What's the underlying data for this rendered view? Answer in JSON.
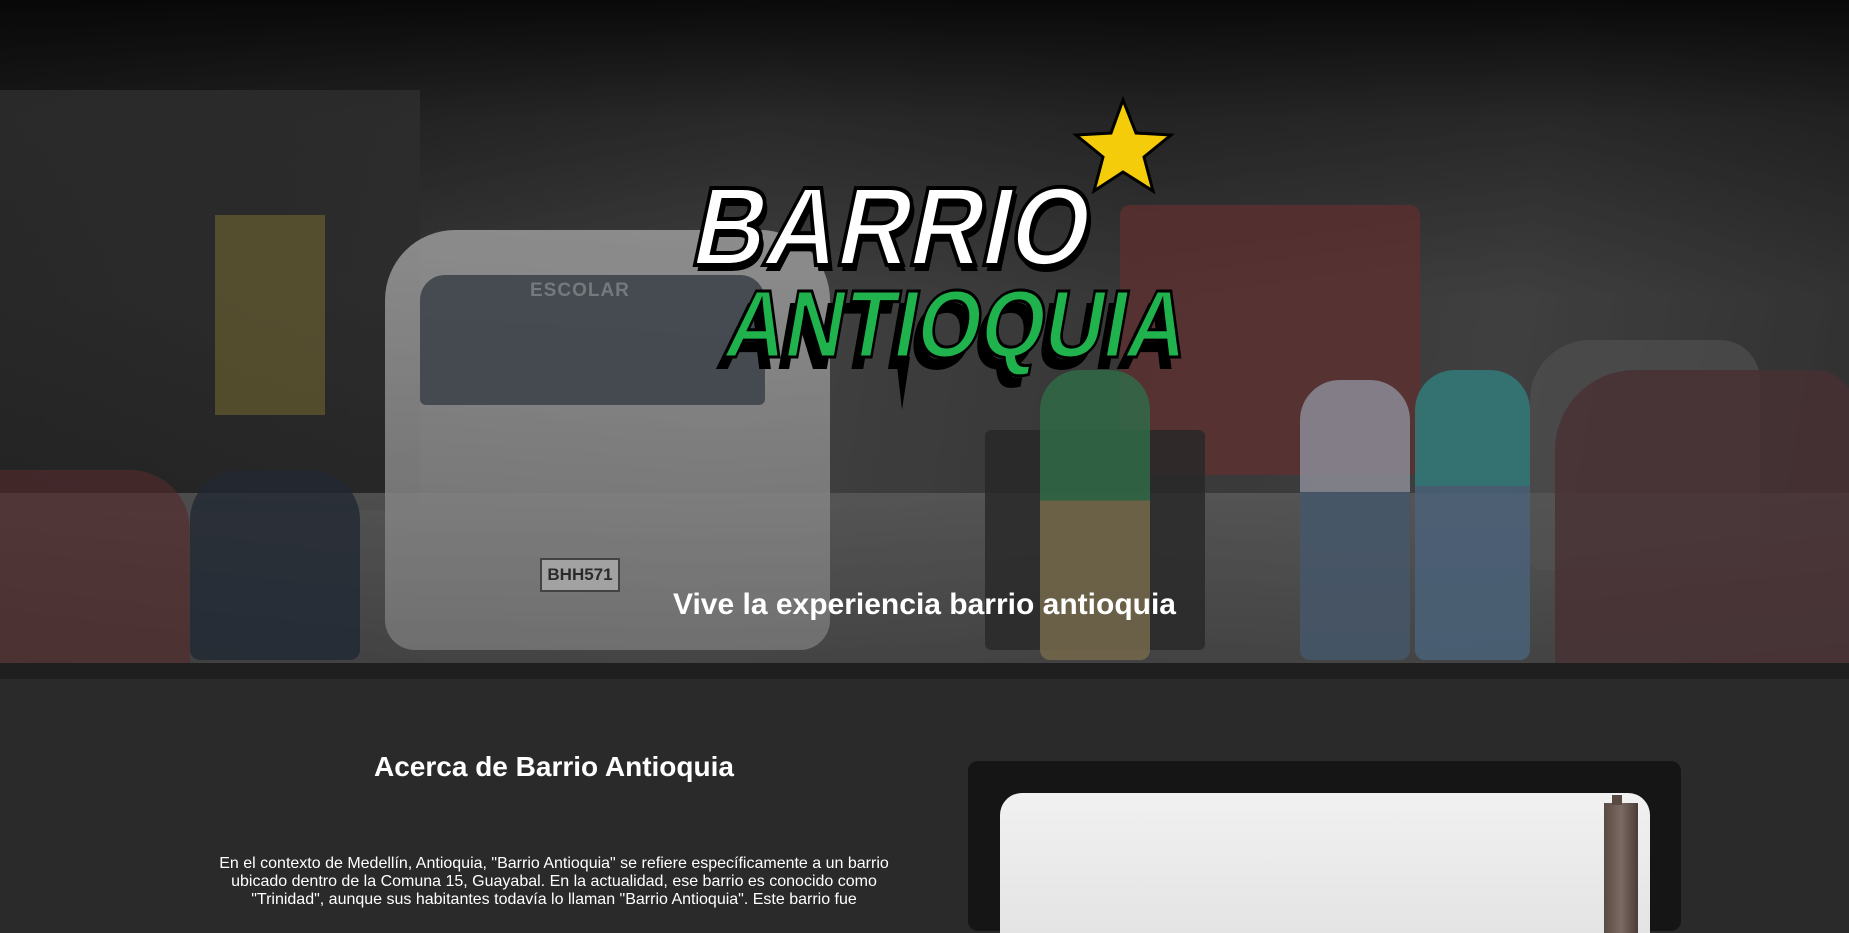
{
  "hero": {
    "logo": {
      "line1": "BARRIO",
      "line2": "ANTIOQUIA",
      "colors": {
        "line1_fill": "#ffffff",
        "line2_fill": "#1fb24d",
        "star": "#f5cc0a",
        "outline": "#000000"
      },
      "icon": "star-icon"
    },
    "background_scene": {
      "van_label": "ESCOLAR",
      "van_plate": "BHH571"
    },
    "tagline": "Vive la experiencia barrio antioquia"
  },
  "about": {
    "title": "Acerca de Barrio Antioquia",
    "text": "En el contexto de Medellín, Antioquia, \"Barrio Antioquia\" se refiere específicamente a un barrio ubicado dentro de la Comuna 15, Guayabal. En la actualidad, ese barrio es conocido como \"Trinidad\", aunque sus habitantes todavía lo llaman \"Barrio Antioquia\". Este barrio fue"
  },
  "colors": {
    "page_background": "#2a2a2a",
    "card_background": "#151515",
    "text": "#ffffff"
  }
}
